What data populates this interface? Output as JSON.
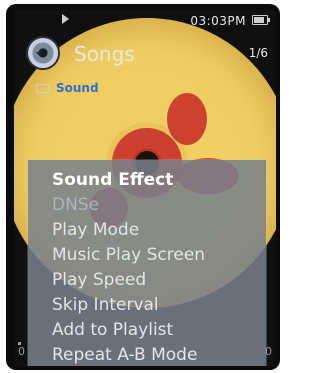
{
  "status": {
    "clock": "03:03PM",
    "battery_level": 0.7
  },
  "header": {
    "title": "Songs",
    "count": "1/6"
  },
  "current_song": {
    "label": "Sound"
  },
  "menu": {
    "items": [
      {
        "label": "Sound Effect",
        "state": "selected"
      },
      {
        "label": "DNSe",
        "state": "disabled"
      },
      {
        "label": "Play Mode",
        "state": "normal"
      },
      {
        "label": "Music Play Screen",
        "state": "normal"
      },
      {
        "label": "Play Speed",
        "state": "normal"
      },
      {
        "label": "Skip Interval",
        "state": "normal"
      },
      {
        "label": "Add to Playlist",
        "state": "normal"
      },
      {
        "label": "Repeat A-B Mode",
        "state": "normal"
      }
    ]
  },
  "progress": {
    "elapsed": "0",
    "total": "0"
  },
  "colors": {
    "menu_background": "#78808a",
    "menu_text": "#e3e6ea",
    "song_label": "#2f6fd0",
    "disc": "#f0cf62",
    "disc_art": "#c8322a"
  },
  "icons": {
    "back": "back-disc-icon",
    "play": "play-icon",
    "battery": "battery-icon",
    "folder": "folder-icon"
  }
}
